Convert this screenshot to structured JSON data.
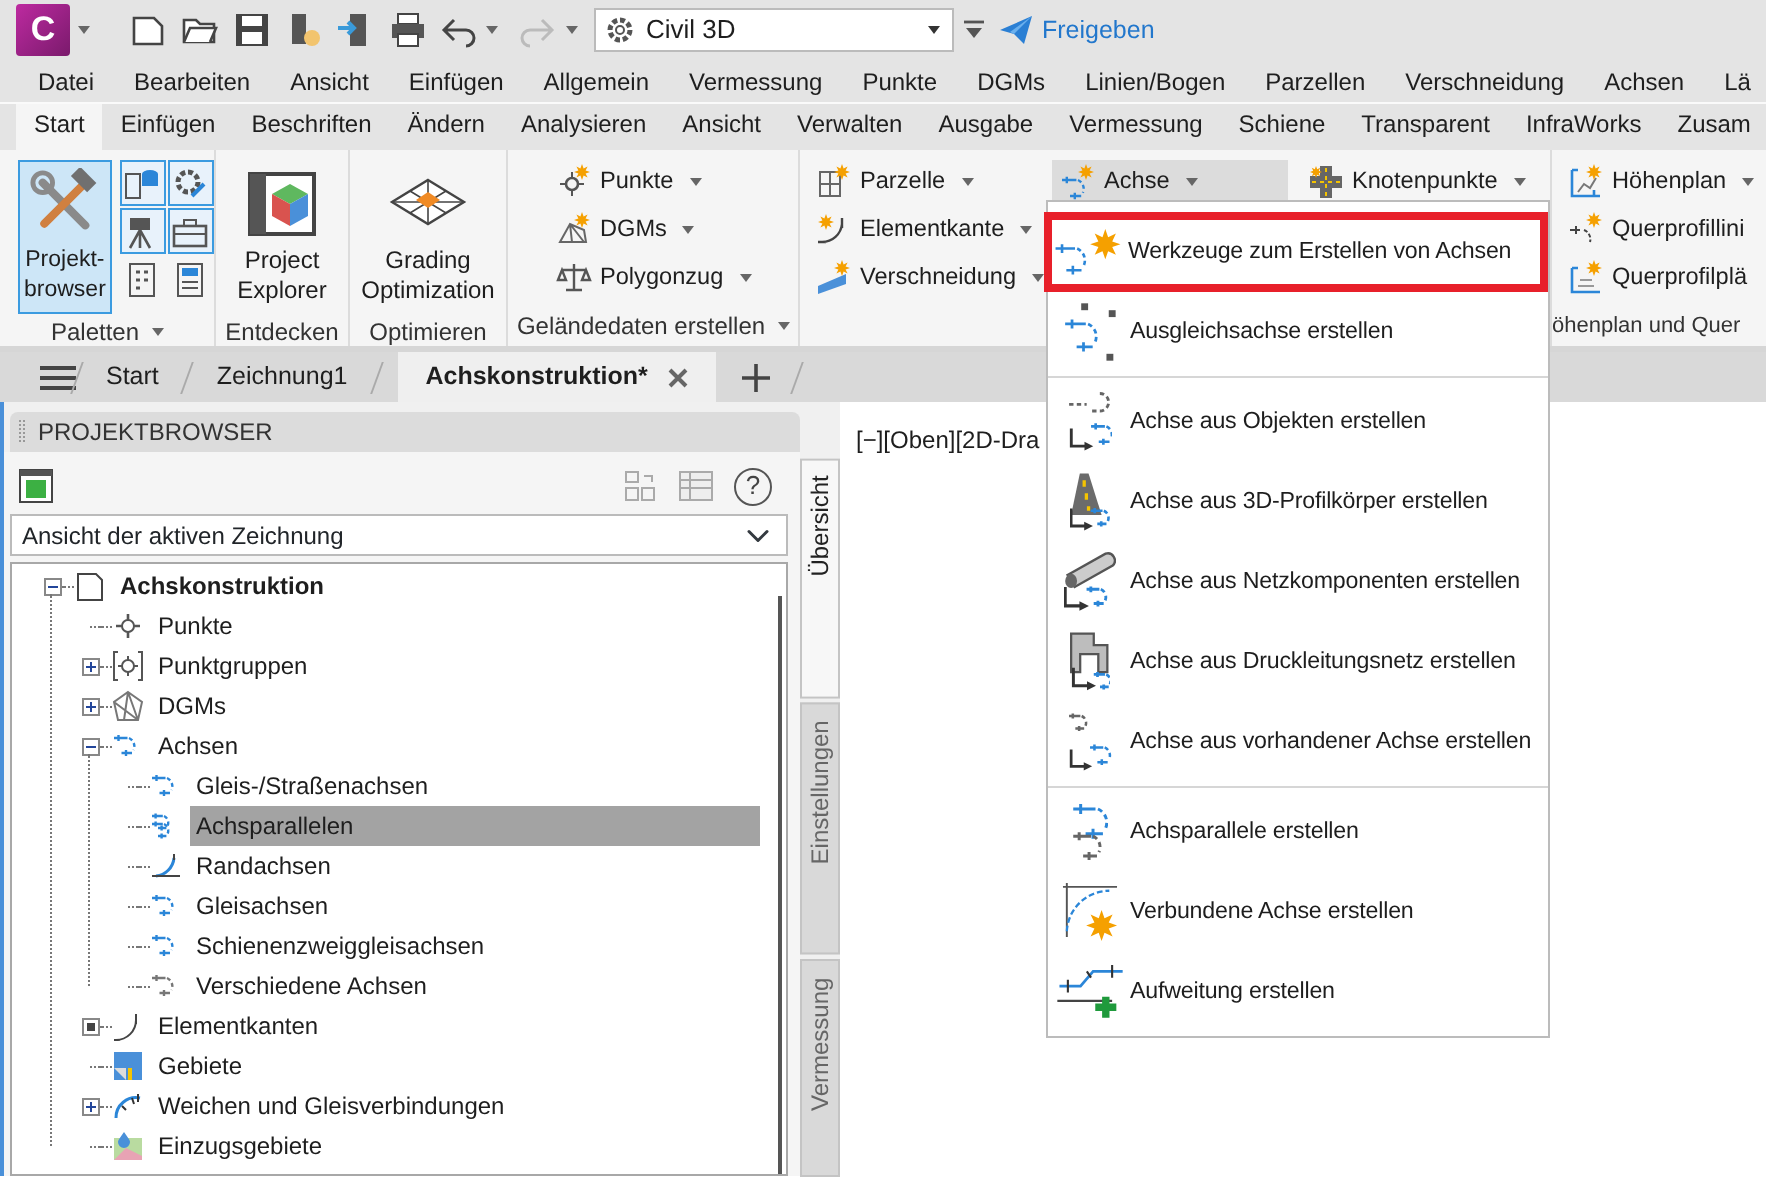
{
  "app_button": {
    "letter": "C"
  },
  "quick_access": {
    "undo": {
      "disabled": false
    },
    "redo": {
      "disabled": true
    }
  },
  "workspace": {
    "value": "Civil 3D"
  },
  "share_button": {
    "label": "Freigeben"
  },
  "menu_bar": [
    "Datei",
    "Bearbeiten",
    "Ansicht",
    "Einfügen",
    "Allgemein",
    "Vermessung",
    "Punkte",
    "DGMs",
    "Linien/Bogen",
    "Parzellen",
    "Verschneidung",
    "Achsen",
    "Lä"
  ],
  "ribbon_tabs": [
    {
      "label": "Start",
      "selected": true
    },
    {
      "label": "Einfügen",
      "selected": false
    },
    {
      "label": "Beschriften",
      "selected": false
    },
    {
      "label": "Ändern",
      "selected": false
    },
    {
      "label": "Analysieren",
      "selected": false
    },
    {
      "label": "Ansicht",
      "selected": false
    },
    {
      "label": "Verwalten",
      "selected": false
    },
    {
      "label": "Ausgabe",
      "selected": false
    },
    {
      "label": "Vermessung",
      "selected": false
    },
    {
      "label": "Schiene",
      "selected": false
    },
    {
      "label": "Transparent",
      "selected": false
    },
    {
      "label": "InfraWorks",
      "selected": false
    },
    {
      "label": "Zusam",
      "selected": false
    }
  ],
  "ribbon_panels": [
    {
      "kind": "palettes",
      "title": "Paletten",
      "menu": true,
      "large": {
        "label": "Projekt-browser",
        "selected": true
      },
      "toggles": [
        {
          "on": true
        },
        {
          "on": true
        },
        {
          "on": true
        },
        {
          "on": true
        },
        {
          "on": false
        },
        {
          "on": false
        }
      ]
    },
    {
      "kind": "large",
      "title": "Entdecken",
      "large": {
        "label": "Project Explorer",
        "selected": false
      }
    },
    {
      "kind": "large",
      "title": "Optimieren",
      "large": {
        "label": "Grading Optimization",
        "selected": false
      }
    },
    {
      "kind": "columns",
      "title": "Geländedaten erstellen",
      "menu": true,
      "columns": [
        [
          {
            "label": "Punkte",
            "dropdown": true,
            "open": false
          },
          {
            "label": "DGMs",
            "dropdown": true,
            "open": false
          },
          {
            "label": "Polygonzug",
            "dropdown": true,
            "open": false
          }
        ]
      ]
    },
    {
      "kind": "columns",
      "columns": [
        [
          {
            "label": "Parzelle",
            "dropdown": true,
            "open": false
          },
          {
            "label": "Elementkante",
            "dropdown": true,
            "open": false
          },
          {
            "label": "Verschneidung",
            "dropdown": true,
            "open": false
          }
        ],
        [
          {
            "label": "Achse",
            "dropdown": true,
            "open": true
          }
        ],
        [
          {
            "label": "Knotenpunkte",
            "dropdown": true,
            "open": false
          }
        ]
      ]
    },
    {
      "kind": "columns",
      "title": "öhenplan und Quer",
      "columns": [
        [
          {
            "label": "Höhenplan",
            "dropdown": true,
            "open": false
          },
          {
            "label": "Querprofillini",
            "dropdown": false,
            "open": false
          },
          {
            "label": "Querprofilplä",
            "dropdown": false,
            "open": false
          }
        ]
      ]
    }
  ],
  "document_tabs": [
    {
      "label": "Start",
      "selected": false
    },
    {
      "label": "Zeichnung1",
      "selected": false
    },
    {
      "label": "Achskonstruktion*",
      "selected": true
    }
  ],
  "project_browser": {
    "title": "PROJEKTBROWSER",
    "help": "?",
    "view": "Ansicht der aktiven Zeichnung",
    "tree": [
      {
        "kind": "group",
        "label": "Achskonstruktion",
        "expanded": true,
        "selected": false,
        "children": [
          {
            "kind": "leaf",
            "label": "Punkte",
            "selected": false
          },
          {
            "kind": "group",
            "label": "Punktgruppen",
            "expanded": false,
            "selected": false
          },
          {
            "kind": "group",
            "label": "DGMs",
            "expanded": false,
            "selected": false
          },
          {
            "kind": "group",
            "label": "Achsen",
            "expanded": true,
            "selected": false,
            "children": [
              {
                "kind": "leaf",
                "label": "Gleis-/Straßenachsen",
                "selected": false
              },
              {
                "kind": "leaf",
                "label": "Achsparallelen",
                "selected": true
              },
              {
                "kind": "leaf",
                "label": "Randachsen",
                "selected": false
              },
              {
                "kind": "leaf",
                "label": "Gleisachsen",
                "selected": false
              },
              {
                "kind": "leaf",
                "label": "Schienenzweiggleisachsen",
                "selected": false
              },
              {
                "kind": "leaf",
                "label": "Verschiedene Achsen",
                "selected": false
              }
            ]
          },
          {
            "kind": "pending",
            "label": "Elementkanten",
            "selected": false
          },
          {
            "kind": "leaf",
            "label": "Gebiete",
            "selected": false
          },
          {
            "kind": "group",
            "label": "Weichen und Gleisverbindungen",
            "expanded": false,
            "selected": false
          },
          {
            "kind": "leaf",
            "label": "Einzugsgebiete",
            "selected": false
          }
        ]
      }
    ],
    "side_tabs": [
      {
        "label": "Übersicht",
        "selected": true
      },
      {
        "label": "Einstellungen",
        "selected": false
      },
      {
        "label": "Vermessung",
        "selected": false
      }
    ]
  },
  "viewport": {
    "label": "[−][Oben][2D-Dra"
  },
  "axis_menu": {
    "items": [
      {
        "kind": "item",
        "label": "Werkzeuge zum Erstellen von Achsen",
        "highlighted": true
      },
      {
        "kind": "item",
        "label": "Ausgleichsachse erstellen",
        "highlighted": false
      },
      {
        "kind": "separator"
      },
      {
        "kind": "item",
        "label": "Achse aus Objekten erstellen",
        "highlighted": false
      },
      {
        "kind": "item",
        "label": "Achse aus 3D-Profilkörper erstellen",
        "highlighted": false
      },
      {
        "kind": "item",
        "label": "Achse aus Netzkomponenten erstellen",
        "highlighted": false
      },
      {
        "kind": "item",
        "label": "Achse aus Druckleitungsnetz erstellen",
        "highlighted": false
      },
      {
        "kind": "item",
        "label": "Achse aus vorhandener Achse erstellen",
        "highlighted": false
      },
      {
        "kind": "separator"
      },
      {
        "kind": "item",
        "label": "Achsparallele erstellen",
        "highlighted": false
      },
      {
        "kind": "item",
        "label": "Verbundene Achse erstellen",
        "highlighted": false
      },
      {
        "kind": "item",
        "label": "Aufweitung erstellen",
        "highlighted": false
      }
    ]
  }
}
